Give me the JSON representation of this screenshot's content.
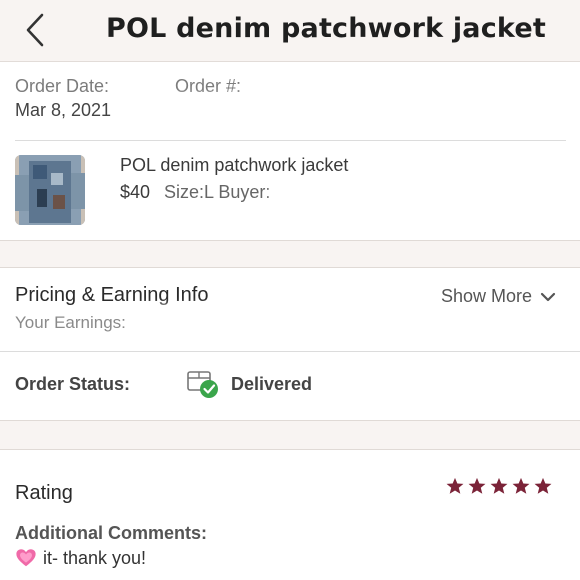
{
  "header": {
    "title": "POL denim patchwork jacket",
    "back_icon": "chevron-left-icon"
  },
  "order": {
    "date_label": "Order Date:",
    "date_value": "Mar 8, 2021",
    "number_label": "Order #:"
  },
  "item": {
    "title": "POL denim patchwork jacket",
    "price": "$40",
    "size_buyer": "Size:L  Buyer:"
  },
  "pricing": {
    "title": "Pricing & Earning Info",
    "show_more": "Show More",
    "earnings_label": "Your Earnings:"
  },
  "status": {
    "label": "Order Status:",
    "value": "Delivered",
    "icon": "package-delivered-icon"
  },
  "rating": {
    "title": "Rating",
    "stars": 5,
    "star_color": "#7b2338",
    "comments_label": "Additional Comments:",
    "comment": "it- thank you!"
  },
  "colors": {
    "header_bg": "#f8f4f2",
    "delivered_check": "#3aa54b"
  }
}
